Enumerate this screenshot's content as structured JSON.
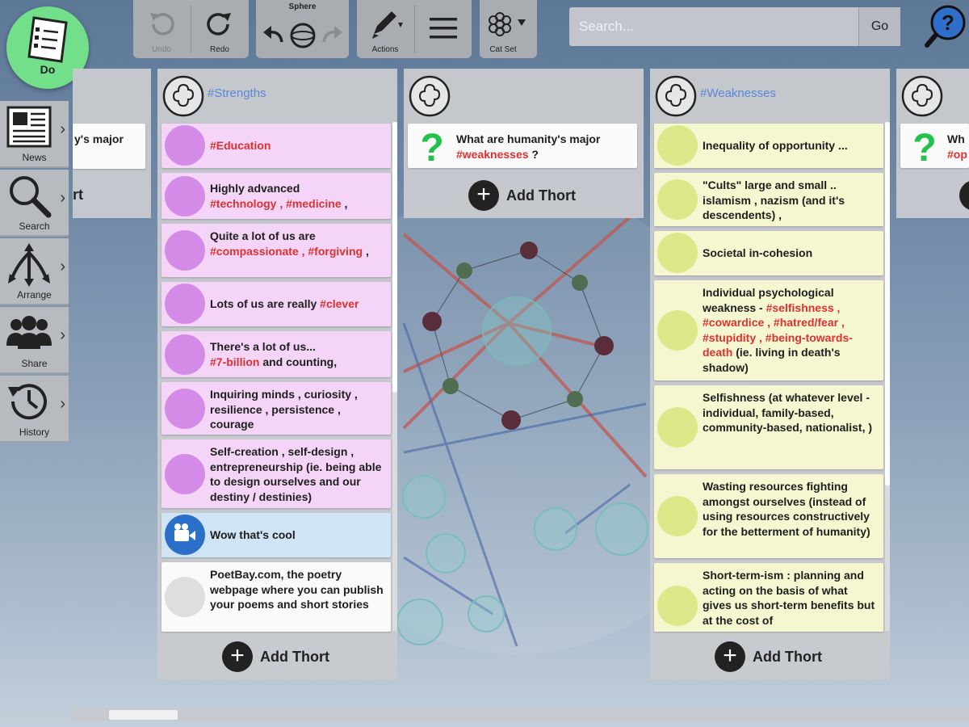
{
  "toolbar": {
    "undo_label": "Undo",
    "redo_label": "Redo",
    "sphere_title": "Sphere",
    "actions_label": "Actions",
    "catset_label": "Cat Set"
  },
  "search": {
    "placeholder": "Search...",
    "go_label": "Go"
  },
  "do_button": {
    "label": "Do"
  },
  "side_menu": {
    "items": [
      {
        "label": "News",
        "icon": "newspaper-icon"
      },
      {
        "label": "Search",
        "icon": "magnifier-icon"
      },
      {
        "label": "Arrange",
        "icon": "arrange-arrows-icon"
      },
      {
        "label": "Share",
        "icon": "people-icon"
      },
      {
        "label": "History",
        "icon": "clock-history-icon"
      }
    ]
  },
  "add_thort_label": "Add Thort",
  "columns": {
    "left_partial": {
      "snippet": "y's major",
      "add_snippet": "rt"
    },
    "strengths": {
      "title": "#Strengths",
      "thorts": [
        {
          "plain": "",
          "tags": "#Education",
          "rest": ""
        },
        {
          "plain": "Highly advanced",
          "tags": "#technology , #medicine",
          "rest": " ,"
        },
        {
          "plain": "Quite a lot of us are",
          "tags": "#compassionate , #forgiving",
          "rest": " ,"
        },
        {
          "plain": "Lots of us are really ",
          "tags": "#clever",
          "rest": ""
        },
        {
          "plain": "There's a lot of us...",
          "tags": "#7-billion",
          "rest": " and counting,"
        },
        {
          "plain": "Inquiring minds , curiosity , resilience , persistence , courage"
        },
        {
          "plain": "Self-creation , self-design , entrepreneurship (ie. being able to design ourselves and our destiny / destinies)"
        },
        {
          "plain": "Wow that's cool"
        },
        {
          "plain": "PoetBay.com, the poetry webpage where you can publish your poems and short stories"
        }
      ]
    },
    "question": {
      "text_plain": "What are humanity's major",
      "text_tag": "#weaknesses",
      "text_rest": " ?"
    },
    "weaknesses": {
      "title": "#Weaknesses",
      "thorts": [
        {
          "plain": "Inequality of opportunity ..."
        },
        {
          "plain": "\"Cults\" large and small .. islamism , nazism (and it's descendents) ,"
        },
        {
          "plain": "Societal in-cohesion"
        },
        {
          "plain": "Individual psychological weakness - ",
          "tags": "#selfishness , #cowardice , #hatred/fear , #stupidity , #being-towards-death",
          "rest": " (ie. living in death's shadow)"
        },
        {
          "plain": "Selfishness (at whatever level - individual, family-based, community-based, nationalist, )"
        },
        {
          "plain": "Wasting resources fighting amongst ourselves (instead of using resources constructively for the betterment of humanity)"
        },
        {
          "plain": "Short-term-ism : planning and acting on the basis of what gives us short-term benefits but at the cost of"
        }
      ]
    },
    "right_partial": {
      "snippet_1": "Wh",
      "snippet_2": "#op"
    }
  },
  "colors": {
    "strength_card": "#f4d4f7",
    "strength_dot": "#d48be8",
    "weakness_card": "#f4f7cf",
    "weakness_dot": "#dde88a",
    "tag_red": "#e03030",
    "header_link_blue": "#5c86d6",
    "question_green": "#22c24a",
    "do_green": "#72e08a"
  }
}
